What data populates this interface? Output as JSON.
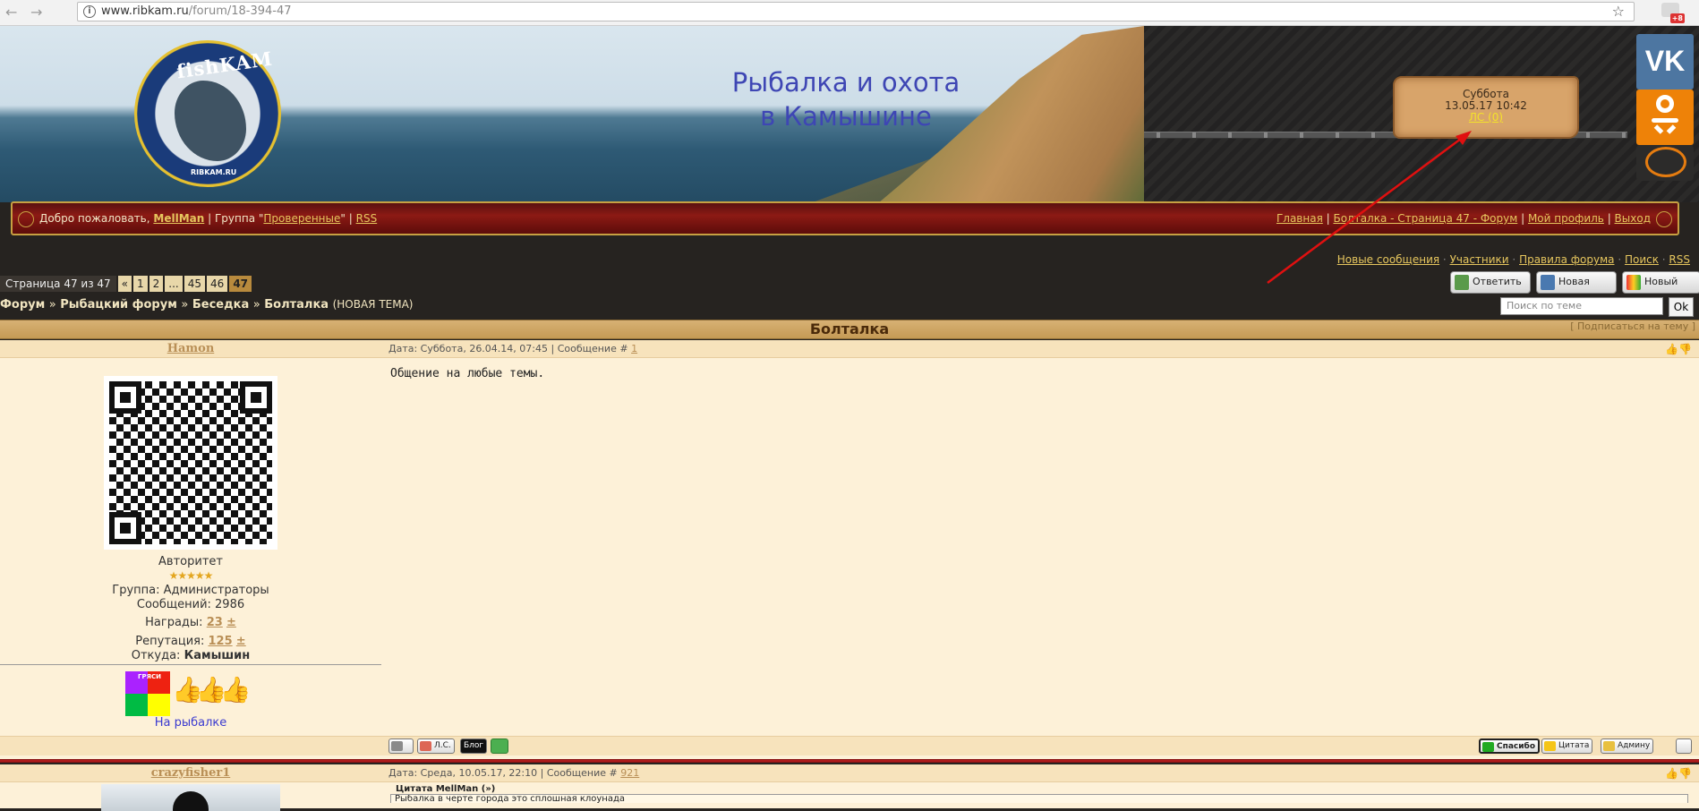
{
  "browser": {
    "url_host": "www.ribkam.ru",
    "url_path": "/forum/18-394-47",
    "ext_badge": "+8"
  },
  "header": {
    "logo_text": "fishKAM",
    "logo_sub": "RIBKAM.RU",
    "site_title_line1": "Рыбалка и охота",
    "site_title_line2": "в Камышине",
    "date_day": "Суббота",
    "date_time": "13.05.17 10:42",
    "pm_link": "ЛС (0)",
    "vk_label": "VK"
  },
  "welcome": {
    "greeting": "Добро пожаловать,",
    "user": "MellMan",
    "group_prefix": "| Группа \"",
    "group": "Проверенные",
    "group_suffix": "\" |",
    "rss": "RSS",
    "links": [
      "Главная",
      "Болталка - Страница 47 - Форум",
      "Мой профиль",
      "Выход"
    ]
  },
  "toplinks": [
    "Новые сообщения",
    "Участники",
    "Правила форума",
    "Поиск",
    "RSS"
  ],
  "pager": {
    "label": "Страница 47 из 47",
    "pages": [
      "«",
      "1",
      "2",
      "...",
      "45",
      "46",
      "47"
    ],
    "current": "47"
  },
  "breadcrumb": {
    "items": [
      "Форум",
      "Рыбацкий форум",
      "Беседка",
      "Болталка"
    ],
    "separator": "»",
    "new_topic": "(НОВАЯ ТЕМА)"
  },
  "actions": {
    "reply": "Ответить",
    "new_topic": "Новая Тема",
    "new_poll": "Новый Опрос",
    "search_placeholder": "Поиск по теме",
    "search_button": "Ok"
  },
  "thread": {
    "title": "Болталка",
    "subscribe": "[ Подписаться на тему ]"
  },
  "posts": [
    {
      "author": "Hamon",
      "meta_prefix": "Дата: Суббота, 26.04.14, 07:45 | Сообщение #",
      "num": "1",
      "body": "Общение на любые темы.",
      "rank": "Авторитет",
      "stars": "★★★★★",
      "group": "Группа: Администраторы",
      "messages": "Сообщений: 2986",
      "awards_label": "Награды:",
      "awards": "23",
      "rep_label": "Репутация:",
      "rep": "125",
      "plus": "±",
      "from_label": "Откуда:",
      "from": "Камышин",
      "badge_text": "ГРЯСИ",
      "status_link": "На рыбалке",
      "foot_left": [
        "",
        "Л.С.",
        "Блог",
        ""
      ],
      "foot_right": [
        "Спасибо",
        "Цитата",
        "Админу"
      ]
    },
    {
      "author": "crazyfisher1",
      "meta_prefix": "Дата: Среда, 10.05.17, 22:10 | Сообщение #",
      "num": "921",
      "quote_head": "Цитата MellMan (",
      "quote_tail": ")",
      "quote_body": "Рыбалка в черте города это сплошная клоунада"
    }
  ],
  "colors": {
    "accent_gold": "#e6c65e",
    "welcome_red": "#8c1a14",
    "post_bg": "#fdf1d8",
    "title_blue": "#3e46b4"
  }
}
